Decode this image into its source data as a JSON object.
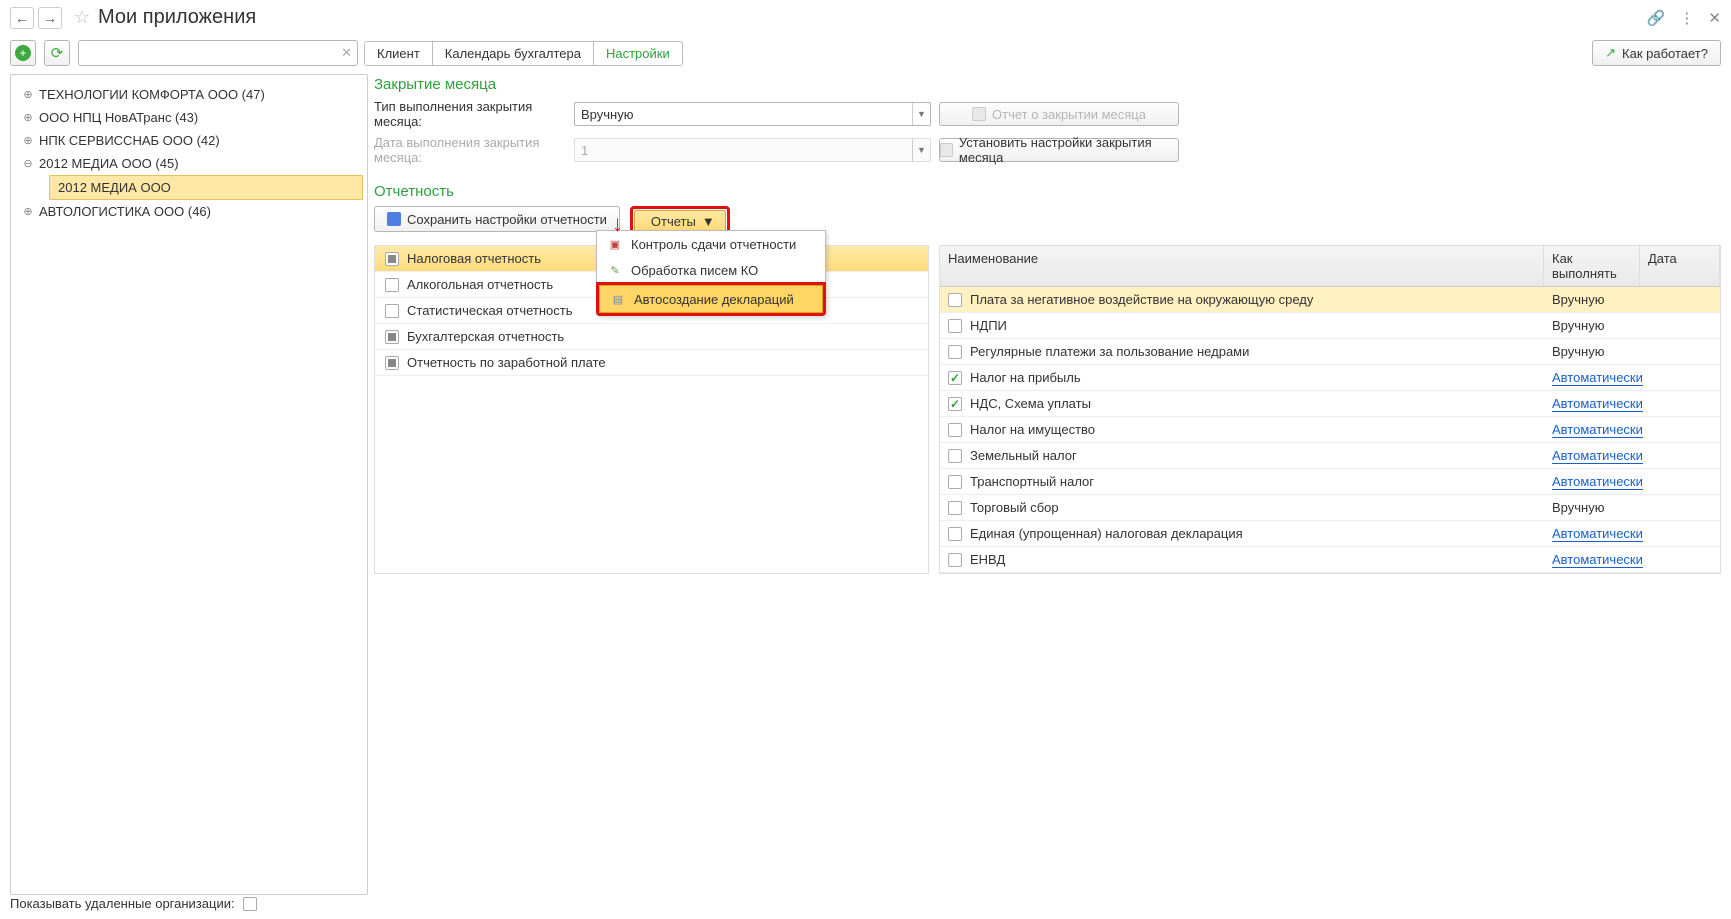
{
  "header": {
    "title": "Мои приложения",
    "how_works": "Как работает?"
  },
  "tabs": [
    "Клиент",
    "Календарь бухгалтера",
    "Настройки"
  ],
  "tree": [
    {
      "label": "ТЕХНОЛОГИИ КОМФОРТА ООО (47)",
      "expanded": false
    },
    {
      "label": "ООО НПЦ НовАТранс (43)",
      "expanded": false
    },
    {
      "label": "НПК СЕРВИССНАБ ООО (42)",
      "expanded": false
    },
    {
      "label": "2012 МЕДИА ООО (45)",
      "expanded": true,
      "child": "2012 МЕДИА ООО"
    },
    {
      "label": "АВТОЛОГИСТИКА ООО (46)",
      "expanded": false
    }
  ],
  "closing": {
    "section": "Закрытие месяца",
    "type_label": "Тип выполнения закрытия месяца:",
    "type_value": "Вручную",
    "date_label": "Дата выполнения закрытия месяца:",
    "date_value": "1",
    "report_btn": "Отчет о закрытии месяца",
    "set_btn": "Установить настройки закрытия месяца"
  },
  "reporting": {
    "section": "Отчетность",
    "save_btn": "Сохранить настройки отчетности",
    "reports_btn": "Отчеты",
    "menu": [
      "Контроль сдачи отчетности",
      "Обработка писем КО",
      "Автосоздание деклараций"
    ],
    "categories": [
      {
        "label": "Налоговая отчетность",
        "state": "partial",
        "selected": true
      },
      {
        "label": "Алкогольная отчетность",
        "state": "empty"
      },
      {
        "label": "Статистическая отчетность",
        "state": "empty"
      },
      {
        "label": "Бухгалтерская отчетность",
        "state": "partial"
      },
      {
        "label": "Отчетность по заработной плате",
        "state": "partial"
      }
    ],
    "table": {
      "head": {
        "name": "Наименование",
        "mode": "Как выполнять",
        "date": "Дата"
      },
      "rows": [
        {
          "name": "Плата за негативное воздействие на окружающую среду",
          "checked": false,
          "mode": "Вручную",
          "link": false,
          "sel": true
        },
        {
          "name": "НДПИ",
          "checked": false,
          "mode": "Вручную",
          "link": false
        },
        {
          "name": "Регулярные платежи за пользование недрами",
          "checked": false,
          "mode": "Вручную",
          "link": false
        },
        {
          "name": "Налог на прибыль",
          "checked": true,
          "mode": "Автоматически",
          "link": true
        },
        {
          "name": "НДС, Схема уплаты",
          "checked": true,
          "mode": "Автоматически",
          "link": true
        },
        {
          "name": "Налог на имущество",
          "checked": false,
          "mode": "Автоматически",
          "link": true
        },
        {
          "name": "Земельный налог",
          "checked": false,
          "mode": "Автоматически",
          "link": true
        },
        {
          "name": "Транспортный налог",
          "checked": false,
          "mode": "Автоматически",
          "link": true
        },
        {
          "name": "Торговый сбор",
          "checked": false,
          "mode": "Вручную",
          "link": false
        },
        {
          "name": "Единая (упрощенная) налоговая декларация",
          "checked": false,
          "mode": "Автоматически",
          "link": true
        },
        {
          "name": "ЕНВД",
          "checked": false,
          "mode": "Автоматически",
          "link": true
        }
      ]
    }
  },
  "footer": {
    "label": "Показывать удаленные организации:"
  }
}
